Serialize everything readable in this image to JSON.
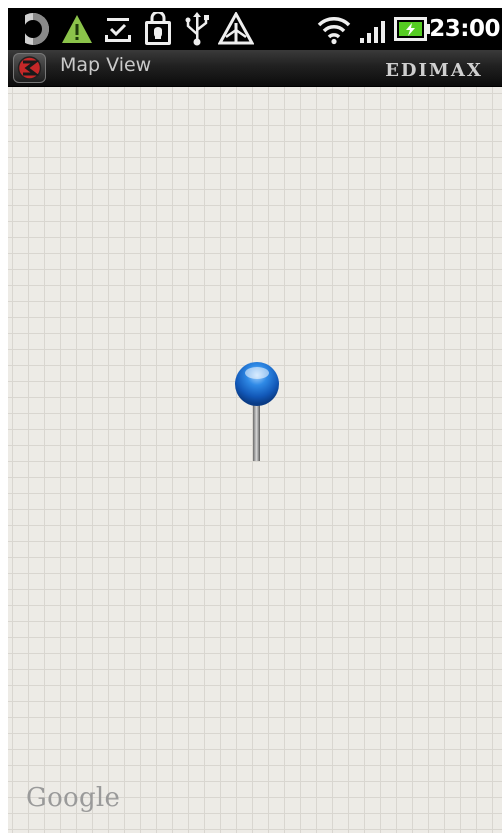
{
  "status_bar": {
    "time": "23:00",
    "icons": [
      "sync-icon",
      "warning-icon",
      "download-icon",
      "shopping-bag-icon",
      "usb-icon",
      "debug-warning-icon",
      "wifi-icon",
      "signal-icon",
      "battery-charging-icon"
    ]
  },
  "title_bar": {
    "app_title": "Map View",
    "brand": "EDIMAX"
  },
  "map": {
    "attribution": "Google"
  },
  "colors": {
    "map_background": "#edebe6",
    "grid_line": "#d9d6d0",
    "pin_head": "#1565c8",
    "warning": "#8bc34a",
    "battery": "#55cc22"
  }
}
